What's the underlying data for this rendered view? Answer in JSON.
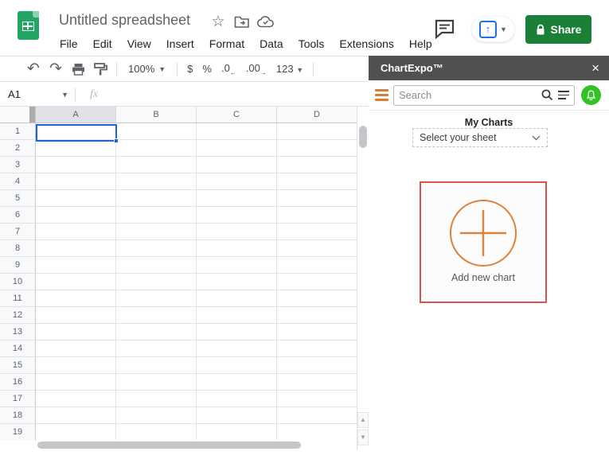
{
  "header": {
    "title": "Untitled spreadsheet",
    "menu_items": [
      "File",
      "Edit",
      "View",
      "Insert",
      "Format",
      "Data",
      "Tools",
      "Extensions",
      "Help"
    ],
    "share_label": "Share",
    "icons": [
      "star-icon",
      "move-folder-icon",
      "cloud-saved-icon",
      "comment-icon",
      "present-icon",
      "lock-icon"
    ]
  },
  "toolbar": {
    "zoom_value": "100%",
    "currency_label": "$",
    "percent_label": "%",
    "decrease_decimal_label": ".0",
    "increase_decimal_label": ".00",
    "number_format_label": "123",
    "icons": [
      "undo-icon",
      "redo-icon",
      "print-icon",
      "paint-format-icon"
    ]
  },
  "formula_bar": {
    "name_box_value": "A1",
    "fx_label": "fx"
  },
  "spreadsheet": {
    "columns": [
      "A",
      "B",
      "C",
      "D"
    ],
    "rows": [
      "1",
      "2",
      "3",
      "4",
      "5",
      "6",
      "7",
      "8",
      "9",
      "10",
      "11",
      "12",
      "13",
      "14",
      "15",
      "16",
      "17",
      "18",
      "19"
    ],
    "selected_cell": "A1",
    "selected_column": "A"
  },
  "sidebar": {
    "title": "ChartExpo™",
    "close_glyph": "×",
    "search_placeholder": "Search",
    "section_title": "My Charts",
    "sheet_select_value": "Select your sheet",
    "add_chart_label": "Add new chart"
  },
  "colors": {
    "share_green": "#1a8038",
    "present_blue": "#1a73e8",
    "selection_blue": "#1967d2",
    "sidebar_header_gray": "#505050",
    "hamburger_orange": "#e07b30",
    "bell_green": "#34c324",
    "card_border_red": "#d9534f",
    "plus_orange": "#e08138",
    "logo_green": "#23a566"
  }
}
